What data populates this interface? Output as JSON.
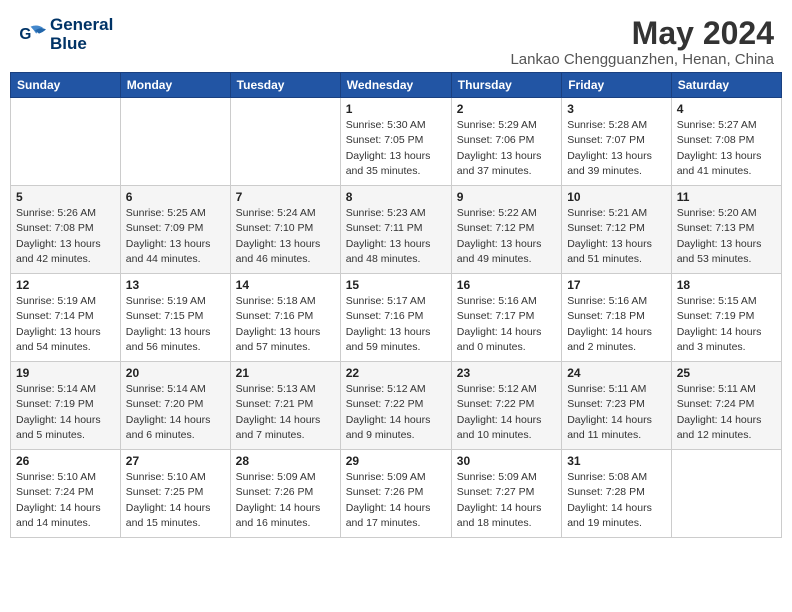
{
  "header": {
    "logo_line1": "General",
    "logo_line2": "Blue",
    "month_year": "May 2024",
    "location": "Lankao Chengguanzhen, Henan, China"
  },
  "weekdays": [
    "Sunday",
    "Monday",
    "Tuesday",
    "Wednesday",
    "Thursday",
    "Friday",
    "Saturday"
  ],
  "weeks": [
    [
      {
        "day": "",
        "info": ""
      },
      {
        "day": "",
        "info": ""
      },
      {
        "day": "",
        "info": ""
      },
      {
        "day": "1",
        "info": "Sunrise: 5:30 AM\nSunset: 7:05 PM\nDaylight: 13 hours\nand 35 minutes."
      },
      {
        "day": "2",
        "info": "Sunrise: 5:29 AM\nSunset: 7:06 PM\nDaylight: 13 hours\nand 37 minutes."
      },
      {
        "day": "3",
        "info": "Sunrise: 5:28 AM\nSunset: 7:07 PM\nDaylight: 13 hours\nand 39 minutes."
      },
      {
        "day": "4",
        "info": "Sunrise: 5:27 AM\nSunset: 7:08 PM\nDaylight: 13 hours\nand 41 minutes."
      }
    ],
    [
      {
        "day": "5",
        "info": "Sunrise: 5:26 AM\nSunset: 7:08 PM\nDaylight: 13 hours\nand 42 minutes."
      },
      {
        "day": "6",
        "info": "Sunrise: 5:25 AM\nSunset: 7:09 PM\nDaylight: 13 hours\nand 44 minutes."
      },
      {
        "day": "7",
        "info": "Sunrise: 5:24 AM\nSunset: 7:10 PM\nDaylight: 13 hours\nand 46 minutes."
      },
      {
        "day": "8",
        "info": "Sunrise: 5:23 AM\nSunset: 7:11 PM\nDaylight: 13 hours\nand 48 minutes."
      },
      {
        "day": "9",
        "info": "Sunrise: 5:22 AM\nSunset: 7:12 PM\nDaylight: 13 hours\nand 49 minutes."
      },
      {
        "day": "10",
        "info": "Sunrise: 5:21 AM\nSunset: 7:12 PM\nDaylight: 13 hours\nand 51 minutes."
      },
      {
        "day": "11",
        "info": "Sunrise: 5:20 AM\nSunset: 7:13 PM\nDaylight: 13 hours\nand 53 minutes."
      }
    ],
    [
      {
        "day": "12",
        "info": "Sunrise: 5:19 AM\nSunset: 7:14 PM\nDaylight: 13 hours\nand 54 minutes."
      },
      {
        "day": "13",
        "info": "Sunrise: 5:19 AM\nSunset: 7:15 PM\nDaylight: 13 hours\nand 56 minutes."
      },
      {
        "day": "14",
        "info": "Sunrise: 5:18 AM\nSunset: 7:16 PM\nDaylight: 13 hours\nand 57 minutes."
      },
      {
        "day": "15",
        "info": "Sunrise: 5:17 AM\nSunset: 7:16 PM\nDaylight: 13 hours\nand 59 minutes."
      },
      {
        "day": "16",
        "info": "Sunrise: 5:16 AM\nSunset: 7:17 PM\nDaylight: 14 hours\nand 0 minutes."
      },
      {
        "day": "17",
        "info": "Sunrise: 5:16 AM\nSunset: 7:18 PM\nDaylight: 14 hours\nand 2 minutes."
      },
      {
        "day": "18",
        "info": "Sunrise: 5:15 AM\nSunset: 7:19 PM\nDaylight: 14 hours\nand 3 minutes."
      }
    ],
    [
      {
        "day": "19",
        "info": "Sunrise: 5:14 AM\nSunset: 7:19 PM\nDaylight: 14 hours\nand 5 minutes."
      },
      {
        "day": "20",
        "info": "Sunrise: 5:14 AM\nSunset: 7:20 PM\nDaylight: 14 hours\nand 6 minutes."
      },
      {
        "day": "21",
        "info": "Sunrise: 5:13 AM\nSunset: 7:21 PM\nDaylight: 14 hours\nand 7 minutes."
      },
      {
        "day": "22",
        "info": "Sunrise: 5:12 AM\nSunset: 7:22 PM\nDaylight: 14 hours\nand 9 minutes."
      },
      {
        "day": "23",
        "info": "Sunrise: 5:12 AM\nSunset: 7:22 PM\nDaylight: 14 hours\nand 10 minutes."
      },
      {
        "day": "24",
        "info": "Sunrise: 5:11 AM\nSunset: 7:23 PM\nDaylight: 14 hours\nand 11 minutes."
      },
      {
        "day": "25",
        "info": "Sunrise: 5:11 AM\nSunset: 7:24 PM\nDaylight: 14 hours\nand 12 minutes."
      }
    ],
    [
      {
        "day": "26",
        "info": "Sunrise: 5:10 AM\nSunset: 7:24 PM\nDaylight: 14 hours\nand 14 minutes."
      },
      {
        "day": "27",
        "info": "Sunrise: 5:10 AM\nSunset: 7:25 PM\nDaylight: 14 hours\nand 15 minutes."
      },
      {
        "day": "28",
        "info": "Sunrise: 5:09 AM\nSunset: 7:26 PM\nDaylight: 14 hours\nand 16 minutes."
      },
      {
        "day": "29",
        "info": "Sunrise: 5:09 AM\nSunset: 7:26 PM\nDaylight: 14 hours\nand 17 minutes."
      },
      {
        "day": "30",
        "info": "Sunrise: 5:09 AM\nSunset: 7:27 PM\nDaylight: 14 hours\nand 18 minutes."
      },
      {
        "day": "31",
        "info": "Sunrise: 5:08 AM\nSunset: 7:28 PM\nDaylight: 14 hours\nand 19 minutes."
      },
      {
        "day": "",
        "info": ""
      }
    ]
  ]
}
